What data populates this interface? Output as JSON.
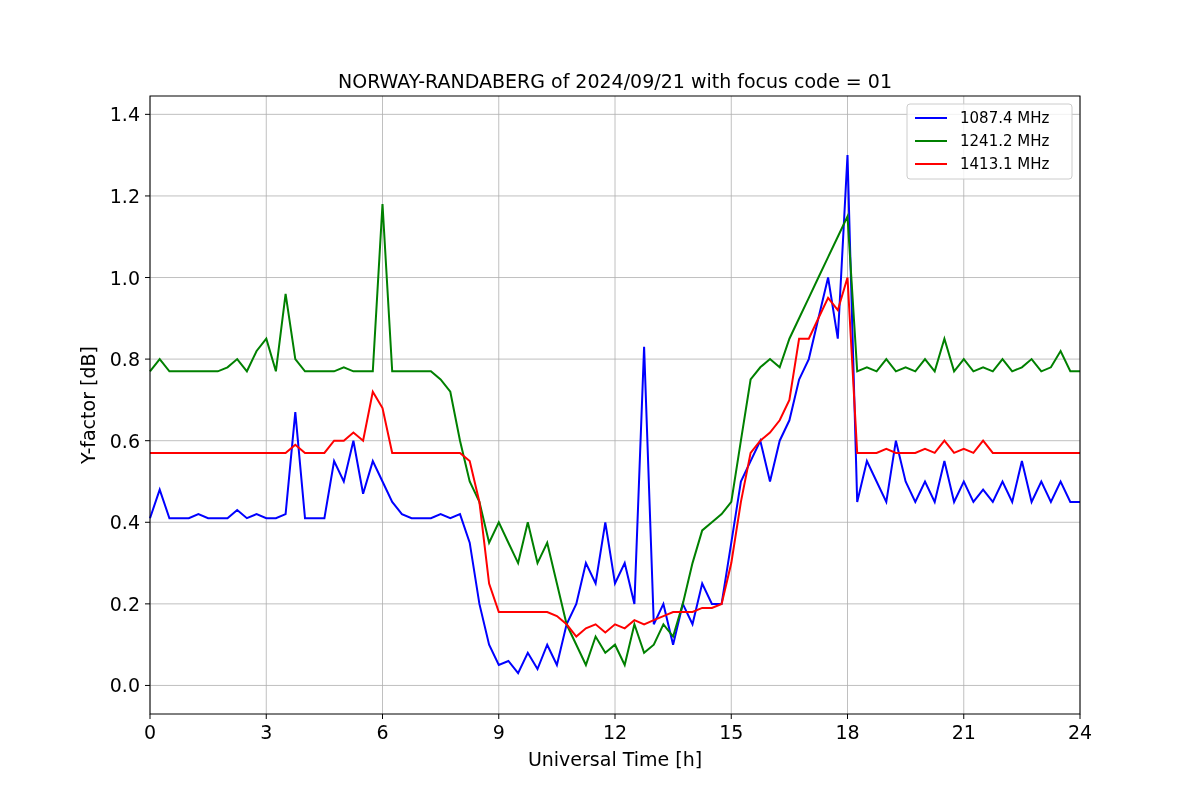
{
  "figure": {
    "chart_data": {
      "type": "line",
      "title": "NORWAY-RANDABERG of 2024/09/21 with focus code = 01",
      "xlabel": "Universal Time [h]",
      "ylabel": "Y-factor [dB]",
      "grid": true,
      "legend": true,
      "xlim": [
        0,
        24
      ],
      "ylim": [
        -0.07,
        1.445
      ],
      "xticks": [
        0,
        3,
        6,
        9,
        12,
        15,
        18,
        21,
        24
      ],
      "yticks": [
        {
          "value": 0,
          "label": "0.0"
        },
        {
          "value": 0.2,
          "label": "0.2"
        },
        {
          "value": 0.4,
          "label": "0.4"
        },
        {
          "value": 0.6,
          "label": "0.6"
        },
        {
          "value": 0.8,
          "label": "0.8"
        },
        {
          "value": 1.0,
          "label": "1.0"
        },
        {
          "value": 1.2,
          "label": "1.2"
        },
        {
          "value": 1.4,
          "label": "1.4"
        }
      ],
      "x": [
        0,
        0.25,
        0.5,
        0.75,
        1,
        1.25,
        1.5,
        1.75,
        2,
        2.25,
        2.5,
        2.75,
        3,
        3.25,
        3.5,
        3.75,
        4,
        4.25,
        4.5,
        4.75,
        5,
        5.25,
        5.5,
        5.75,
        6,
        6.25,
        6.5,
        6.75,
        7,
        7.25,
        7.5,
        7.75,
        8,
        8.25,
        8.5,
        8.75,
        9,
        9.25,
        9.5,
        9.75,
        10,
        10.25,
        10.5,
        10.75,
        11,
        11.25,
        11.5,
        11.75,
        12,
        12.25,
        12.5,
        12.75,
        13,
        13.25,
        13.5,
        13.75,
        14,
        14.25,
        14.5,
        14.75,
        15,
        15.25,
        15.5,
        15.75,
        16,
        16.25,
        16.5,
        16.75,
        17,
        17.25,
        17.5,
        17.75,
        18,
        18.25,
        18.5,
        18.75,
        19,
        19.25,
        19.5,
        19.75,
        20,
        20.25,
        20.5,
        20.75,
        21,
        21.25,
        21.5,
        21.75,
        22,
        22.25,
        22.5,
        22.75,
        23,
        23.25,
        23.5,
        23.75,
        24
      ],
      "series": [
        {
          "name": "1087.4 MHz",
          "color": "#0000ff",
          "values": [
            0.41,
            0.48,
            0.41,
            0.41,
            0.41,
            0.42,
            0.41,
            0.41,
            0.41,
            0.43,
            0.41,
            0.42,
            0.41,
            0.41,
            0.42,
            0.67,
            0.41,
            0.41,
            0.41,
            0.55,
            0.5,
            0.6,
            0.47,
            0.55,
            0.5,
            0.45,
            0.42,
            0.41,
            0.41,
            0.41,
            0.42,
            0.41,
            0.42,
            0.35,
            0.2,
            0.1,
            0.05,
            0.06,
            0.03,
            0.08,
            0.04,
            0.1,
            0.05,
            0.15,
            0.2,
            0.3,
            0.25,
            0.4,
            0.25,
            0.3,
            0.2,
            0.83,
            0.15,
            0.2,
            0.1,
            0.2,
            0.15,
            0.25,
            0.2,
            0.2,
            0.35,
            0.5,
            0.55,
            0.6,
            0.5,
            0.6,
            0.65,
            0.75,
            0.8,
            0.9,
            1.0,
            0.85,
            1.3,
            0.45,
            0.55,
            0.5,
            0.45,
            0.6,
            0.5,
            0.45,
            0.5,
            0.45,
            0.55,
            0.45,
            0.5,
            0.45,
            0.48,
            0.45,
            0.5,
            0.45,
            0.55,
            0.45,
            0.5,
            0.45,
            0.5,
            0.45,
            0.45
          ]
        },
        {
          "name": "1241.2 MHz",
          "color": "#008000",
          "values": [
            0.77,
            0.8,
            0.77,
            0.77,
            0.77,
            0.77,
            0.77,
            0.77,
            0.78,
            0.8,
            0.77,
            0.82,
            0.85,
            0.77,
            0.96,
            0.8,
            0.77,
            0.77,
            0.77,
            0.77,
            0.78,
            0.77,
            0.77,
            0.77,
            1.18,
            0.77,
            0.77,
            0.77,
            0.77,
            0.77,
            0.75,
            0.72,
            0.6,
            0.5,
            0.45,
            0.35,
            0.4,
            0.35,
            0.3,
            0.4,
            0.3,
            0.35,
            0.25,
            0.15,
            0.1,
            0.05,
            0.12,
            0.08,
            0.1,
            0.05,
            0.15,
            0.08,
            0.1,
            0.15,
            0.12,
            0.2,
            0.3,
            0.38,
            0.4,
            0.42,
            0.45,
            0.6,
            0.75,
            0.78,
            0.8,
            0.78,
            0.85,
            0.9,
            0.95,
            1.0,
            1.05,
            1.1,
            1.15,
            0.77,
            0.78,
            0.77,
            0.8,
            0.77,
            0.78,
            0.77,
            0.8,
            0.77,
            0.85,
            0.77,
            0.8,
            0.77,
            0.78,
            0.77,
            0.8,
            0.77,
            0.78,
            0.8,
            0.77,
            0.78,
            0.82,
            0.77,
            0.77
          ]
        },
        {
          "name": "1413.1 MHz",
          "color": "#ff0000",
          "values": [
            0.57,
            0.57,
            0.57,
            0.57,
            0.57,
            0.57,
            0.57,
            0.57,
            0.57,
            0.57,
            0.57,
            0.57,
            0.57,
            0.57,
            0.57,
            0.59,
            0.57,
            0.57,
            0.57,
            0.6,
            0.6,
            0.62,
            0.6,
            0.72,
            0.68,
            0.57,
            0.57,
            0.57,
            0.57,
            0.57,
            0.57,
            0.57,
            0.57,
            0.55,
            0.45,
            0.25,
            0.18,
            0.18,
            0.18,
            0.18,
            0.18,
            0.18,
            0.17,
            0.15,
            0.12,
            0.14,
            0.15,
            0.13,
            0.15,
            0.14,
            0.16,
            0.15,
            0.16,
            0.17,
            0.18,
            0.18,
            0.18,
            0.19,
            0.19,
            0.2,
            0.3,
            0.45,
            0.57,
            0.6,
            0.62,
            0.65,
            0.7,
            0.85,
            0.85,
            0.9,
            0.95,
            0.92,
            1.0,
            0.57,
            0.57,
            0.57,
            0.58,
            0.57,
            0.57,
            0.57,
            0.58,
            0.57,
            0.6,
            0.57,
            0.58,
            0.57,
            0.6,
            0.57,
            0.57,
            0.57,
            0.57,
            0.57,
            0.57,
            0.57,
            0.57,
            0.57,
            0.57
          ]
        }
      ]
    }
  }
}
